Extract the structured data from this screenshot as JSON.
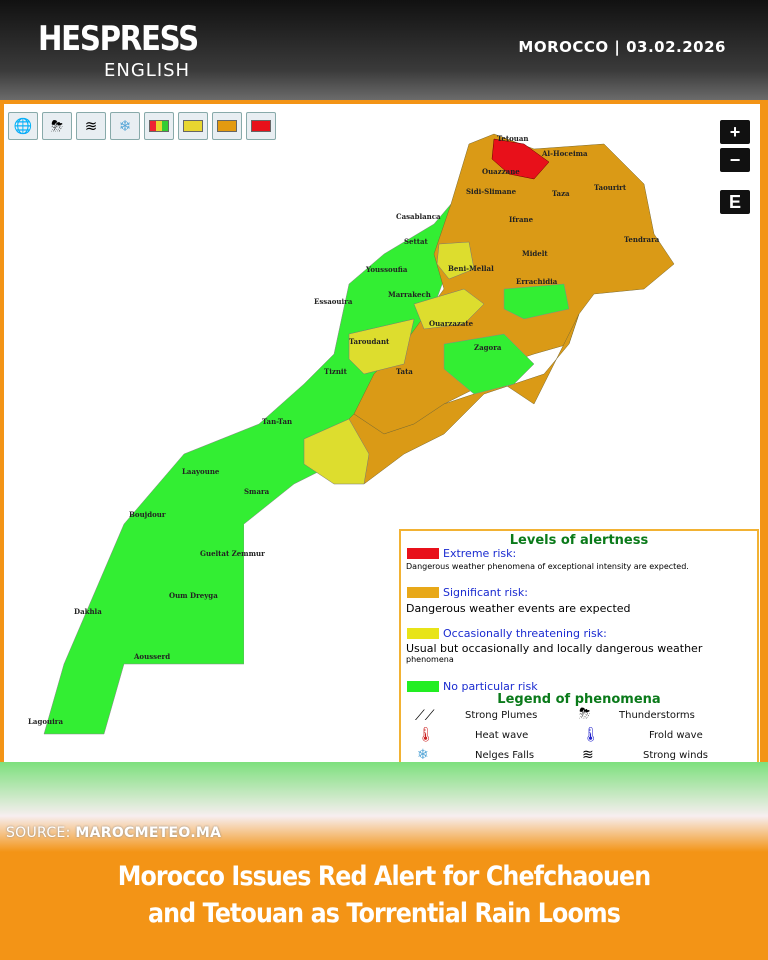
{
  "brand": {
    "name": "HESPRESS",
    "edition": "ENGLISH"
  },
  "dateline": "MOROCCO | 03.02.2026",
  "toolbar": {
    "buttons": [
      {
        "icon": "globe-icon",
        "glyph": "🌐"
      },
      {
        "icon": "thunderstorm-icon",
        "glyph": "⛈"
      },
      {
        "icon": "wind-icon",
        "glyph": "≋"
      },
      {
        "icon": "snowflake-icon",
        "glyph": "❄"
      },
      {
        "icon": "multi-level-icon",
        "color": "#e23"
      },
      {
        "icon": "level-yellow-icon",
        "color": "#e8d630"
      },
      {
        "icon": "level-orange-icon",
        "color": "#e39a10"
      },
      {
        "icon": "level-red-icon",
        "color": "#e8101a"
      }
    ]
  },
  "map": {
    "zoom_in": "+",
    "zoom_out": "−",
    "extra_button": "E",
    "colors": {
      "red": "#e8101a",
      "orange": "#da9a16",
      "yellow": "#dddd2e",
      "green": "#33ee33"
    },
    "cities": [
      "Tetouan",
      "Al-Hoceima",
      "Ouazzane",
      "Sidi-Slimane",
      "Taza",
      "Taourirt",
      "Casablanca",
      "Ifrane",
      "Tendrara",
      "Settat",
      "Midelt",
      "Youssoufia",
      "Beni-Mellal",
      "Errachidia",
      "Essaouira",
      "Marrakech",
      "Ouarzazate",
      "Taroudant",
      "Zagora",
      "Tiznit",
      "Tata",
      "Tan-Tan",
      "Laayoune",
      "Smara",
      "Boujdour",
      "Gueltat Zemmur",
      "Oum Dreyga",
      "Dakhla",
      "Aousserd",
      "Lagouira"
    ]
  },
  "legend": {
    "title": "Levels of alertness",
    "levels": [
      {
        "name": "Extreme risk:",
        "color": "#e8101a",
        "desc": "Dangerous weather phenomena of exceptional intensity are expected."
      },
      {
        "name": "Significant risk:",
        "color": "#e8a818",
        "desc": "Dangerous weather events are expected"
      },
      {
        "name": "Occasionally threatening risk:",
        "color": "#e8e418",
        "desc": "Usual but occasionally and locally dangerous weather",
        "desc2": "phenomena"
      },
      {
        "name": "No particular risk",
        "color": "#22ee22"
      }
    ],
    "phenomena_title": "Legend of phenomena",
    "phenomena": [
      {
        "icon": "strong-plumes-icon",
        "glyph": "⟋⟋",
        "label": "Strong Plumes"
      },
      {
        "icon": "thunderstorm-icon",
        "glyph": "⛈",
        "label": "Thunderstorms"
      },
      {
        "icon": "heat-thermometer-icon",
        "glyph": "🌡",
        "label": "Heat wave"
      },
      {
        "icon": "cold-thermometer-icon",
        "glyph": "🌡",
        "label": "Frold wave"
      },
      {
        "icon": "snowflake-icon",
        "glyph": "❄",
        "label": "Nelges Falls"
      },
      {
        "icon": "wind-icon",
        "glyph": "≋",
        "label": "Strong winds"
      }
    ]
  },
  "source": {
    "prefix": "SOURCE",
    "name": "MAROCMETEO.MA"
  },
  "headline": {
    "line1": "Morocco Issues Red Alert for Chefchaouen",
    "line2": "and Tetouan as Torrential Rain Looms"
  }
}
